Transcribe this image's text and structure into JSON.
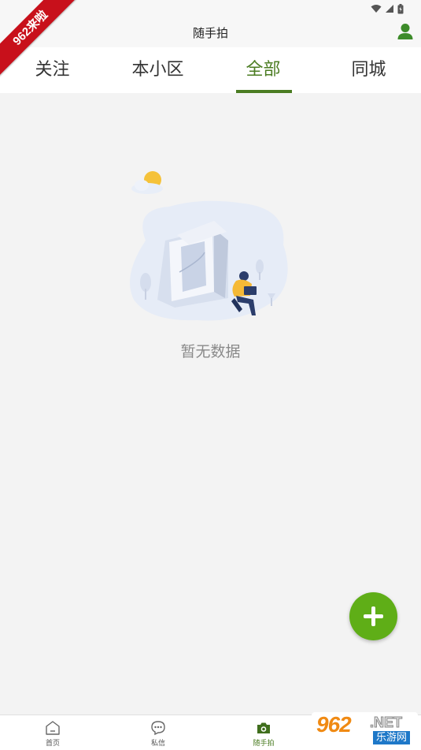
{
  "header": {
    "title": "随手拍"
  },
  "watermarks": {
    "corner_ribbon": "962来啦",
    "bottom_main": "962",
    "bottom_net": ".NET",
    "bottom_sub": "乐游网"
  },
  "tabs": [
    {
      "label": "关注",
      "active": false
    },
    {
      "label": "本小区",
      "active": false
    },
    {
      "label": "全部",
      "active": true
    },
    {
      "label": "同城",
      "active": false
    }
  ],
  "empty_state": {
    "text": "暂无数据"
  },
  "bottom_nav": [
    {
      "label": "首页",
      "icon": "home-icon",
      "active": false
    },
    {
      "label": "私信",
      "icon": "message-icon",
      "active": false
    },
    {
      "label": "随手拍",
      "icon": "camera-icon",
      "active": true
    },
    {
      "label": "",
      "icon": "profile-icon",
      "active": false
    }
  ],
  "colors": {
    "accent": "#4b7c22",
    "fab": "#5fae17",
    "background": "#f3f3f3"
  }
}
